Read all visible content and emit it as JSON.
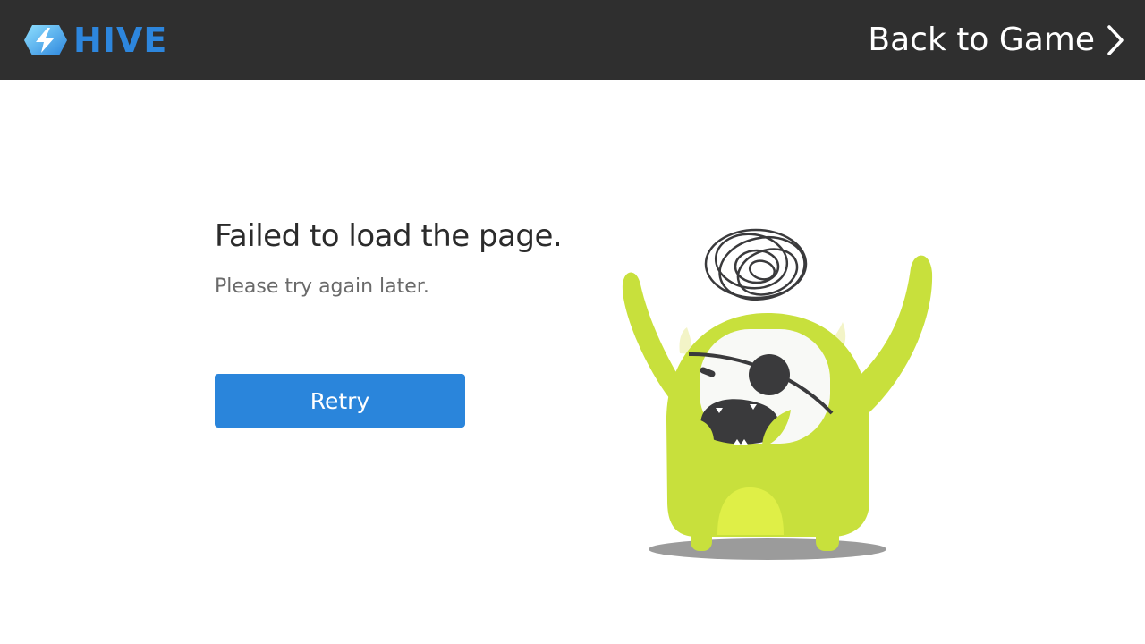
{
  "header": {
    "brand": "HIVE",
    "back_label": "Back to Game"
  },
  "error": {
    "title": "Failed to load the page.",
    "message": "Please try again later.",
    "retry_label": "Retry"
  },
  "colors": {
    "header_bg": "#2f2f2f",
    "brand_blue": "#2d86dd",
    "button_blue": "#2a85db",
    "monster_green": "#c8e03c"
  },
  "icons": {
    "logo": "hive-logo-icon",
    "back": "chevron-right-icon",
    "illustration": "confused-monster-illustration"
  }
}
